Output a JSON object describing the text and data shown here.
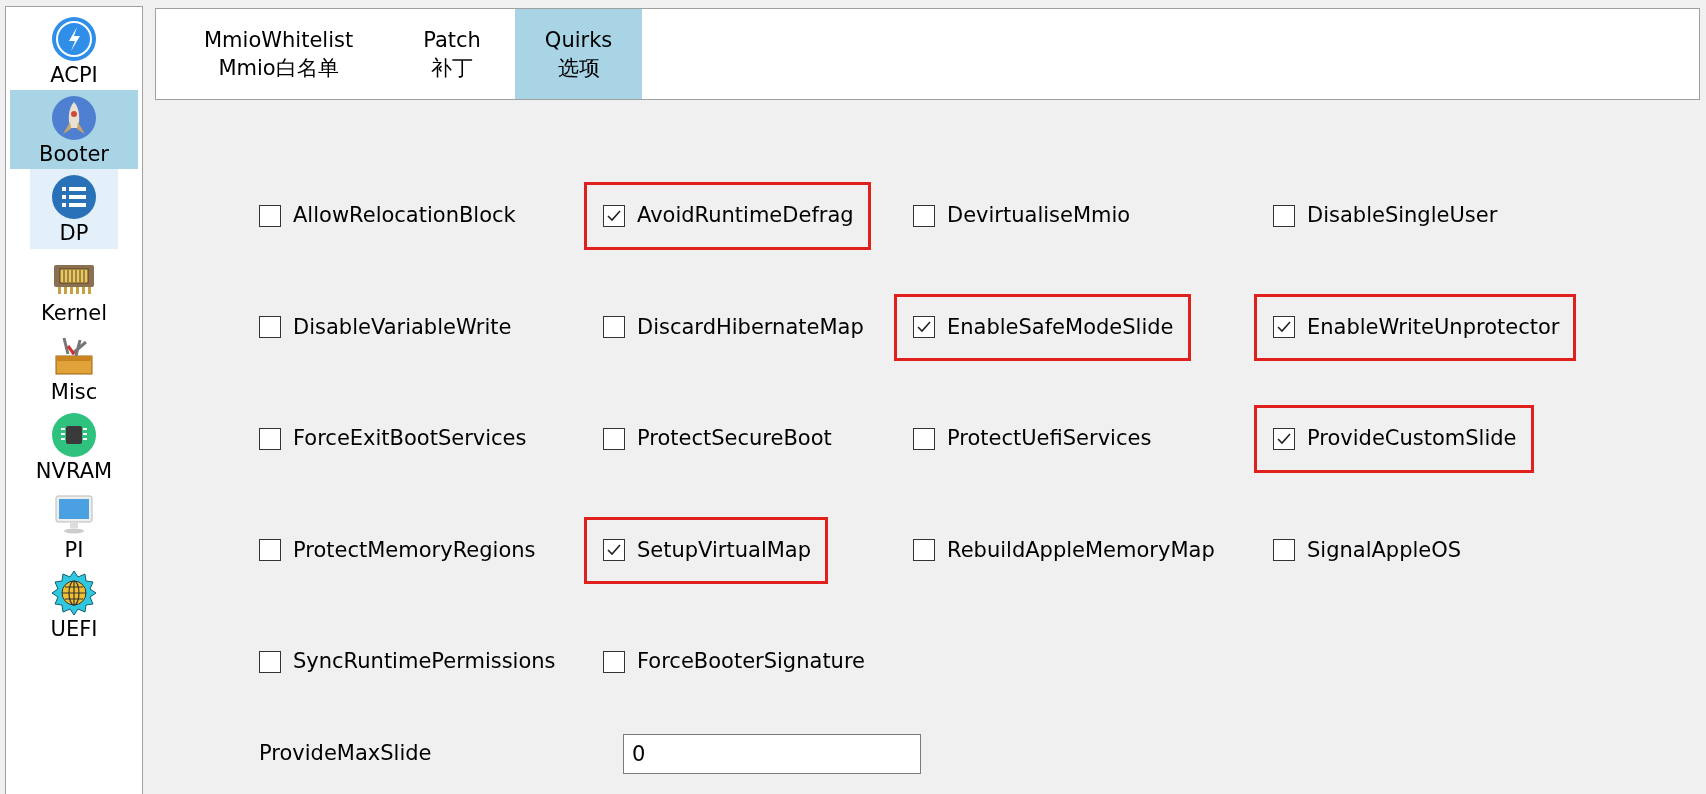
{
  "sidebar": {
    "items": [
      {
        "label": "ACPI",
        "selected": false,
        "hovered": false
      },
      {
        "label": "Booter",
        "selected": true,
        "hovered": false
      },
      {
        "label": "DP",
        "selected": false,
        "hovered": true
      },
      {
        "label": "Kernel",
        "selected": false,
        "hovered": false
      },
      {
        "label": "Misc",
        "selected": false,
        "hovered": false
      },
      {
        "label": "NVRAM",
        "selected": false,
        "hovered": false
      },
      {
        "label": "PI",
        "selected": false,
        "hovered": false
      },
      {
        "label": "UEFI",
        "selected": false,
        "hovered": false
      }
    ]
  },
  "tabs": [
    {
      "label": "MmioWhitelist",
      "sublabel": "Mmio白名单",
      "selected": false
    },
    {
      "label": "Patch",
      "sublabel": "补丁",
      "selected": false
    },
    {
      "label": "Quirks",
      "sublabel": "选项",
      "selected": true
    }
  ],
  "quirks": [
    {
      "label": "AllowRelocationBlock",
      "checked": false,
      "highlighted": false
    },
    {
      "label": "AvoidRuntimeDefrag",
      "checked": true,
      "highlighted": true
    },
    {
      "label": "DevirtualiseMmio",
      "checked": false,
      "highlighted": false
    },
    {
      "label": "DisableSingleUser",
      "checked": false,
      "highlighted": false
    },
    {
      "label": "DisableVariableWrite",
      "checked": false,
      "highlighted": false
    },
    {
      "label": "DiscardHibernateMap",
      "checked": false,
      "highlighted": false
    },
    {
      "label": "EnableSafeModeSlide",
      "checked": true,
      "highlighted": true
    },
    {
      "label": "EnableWriteUnprotector",
      "checked": true,
      "highlighted": true
    },
    {
      "label": "ForceExitBootServices",
      "checked": false,
      "highlighted": false
    },
    {
      "label": "ProtectSecureBoot",
      "checked": false,
      "highlighted": false
    },
    {
      "label": "ProtectUefiServices",
      "checked": false,
      "highlighted": false
    },
    {
      "label": "ProvideCustomSlide",
      "checked": true,
      "highlighted": true
    },
    {
      "label": "ProtectMemoryRegions",
      "checked": false,
      "highlighted": false
    },
    {
      "label": "SetupVirtualMap",
      "checked": true,
      "highlighted": true
    },
    {
      "label": "RebuildAppleMemoryMap",
      "checked": false,
      "highlighted": false
    },
    {
      "label": "SignalAppleOS",
      "checked": false,
      "highlighted": false
    },
    {
      "label": "SyncRuntimePermissions",
      "checked": false,
      "highlighted": false
    },
    {
      "label": "ForceBooterSignature",
      "checked": false,
      "highlighted": false
    }
  ],
  "provide_max_slide": {
    "label": "ProvideMaxSlide",
    "value": "0"
  }
}
